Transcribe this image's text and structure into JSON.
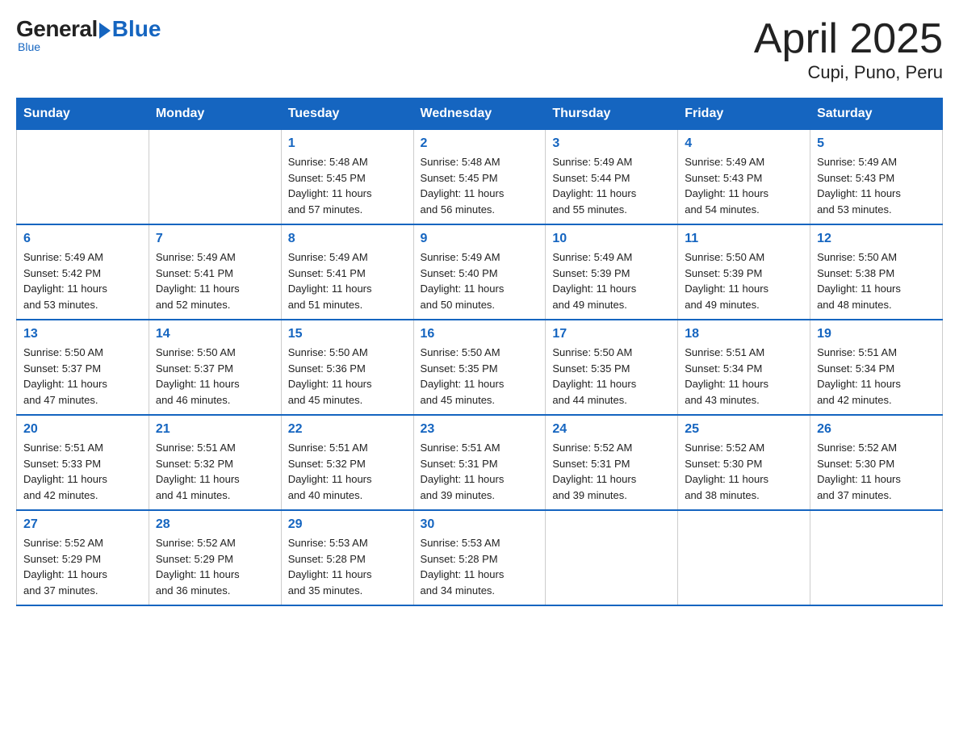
{
  "header": {
    "logo_general": "General",
    "logo_blue": "Blue",
    "title": "April 2025",
    "subtitle": "Cupi, Puno, Peru"
  },
  "weekdays": [
    "Sunday",
    "Monday",
    "Tuesday",
    "Wednesday",
    "Thursday",
    "Friday",
    "Saturday"
  ],
  "weeks": [
    [
      {
        "day": "",
        "info": ""
      },
      {
        "day": "",
        "info": ""
      },
      {
        "day": "1",
        "info": "Sunrise: 5:48 AM\nSunset: 5:45 PM\nDaylight: 11 hours\nand 57 minutes."
      },
      {
        "day": "2",
        "info": "Sunrise: 5:48 AM\nSunset: 5:45 PM\nDaylight: 11 hours\nand 56 minutes."
      },
      {
        "day": "3",
        "info": "Sunrise: 5:49 AM\nSunset: 5:44 PM\nDaylight: 11 hours\nand 55 minutes."
      },
      {
        "day": "4",
        "info": "Sunrise: 5:49 AM\nSunset: 5:43 PM\nDaylight: 11 hours\nand 54 minutes."
      },
      {
        "day": "5",
        "info": "Sunrise: 5:49 AM\nSunset: 5:43 PM\nDaylight: 11 hours\nand 53 minutes."
      }
    ],
    [
      {
        "day": "6",
        "info": "Sunrise: 5:49 AM\nSunset: 5:42 PM\nDaylight: 11 hours\nand 53 minutes."
      },
      {
        "day": "7",
        "info": "Sunrise: 5:49 AM\nSunset: 5:41 PM\nDaylight: 11 hours\nand 52 minutes."
      },
      {
        "day": "8",
        "info": "Sunrise: 5:49 AM\nSunset: 5:41 PM\nDaylight: 11 hours\nand 51 minutes."
      },
      {
        "day": "9",
        "info": "Sunrise: 5:49 AM\nSunset: 5:40 PM\nDaylight: 11 hours\nand 50 minutes."
      },
      {
        "day": "10",
        "info": "Sunrise: 5:49 AM\nSunset: 5:39 PM\nDaylight: 11 hours\nand 49 minutes."
      },
      {
        "day": "11",
        "info": "Sunrise: 5:50 AM\nSunset: 5:39 PM\nDaylight: 11 hours\nand 49 minutes."
      },
      {
        "day": "12",
        "info": "Sunrise: 5:50 AM\nSunset: 5:38 PM\nDaylight: 11 hours\nand 48 minutes."
      }
    ],
    [
      {
        "day": "13",
        "info": "Sunrise: 5:50 AM\nSunset: 5:37 PM\nDaylight: 11 hours\nand 47 minutes."
      },
      {
        "day": "14",
        "info": "Sunrise: 5:50 AM\nSunset: 5:37 PM\nDaylight: 11 hours\nand 46 minutes."
      },
      {
        "day": "15",
        "info": "Sunrise: 5:50 AM\nSunset: 5:36 PM\nDaylight: 11 hours\nand 45 minutes."
      },
      {
        "day": "16",
        "info": "Sunrise: 5:50 AM\nSunset: 5:35 PM\nDaylight: 11 hours\nand 45 minutes."
      },
      {
        "day": "17",
        "info": "Sunrise: 5:50 AM\nSunset: 5:35 PM\nDaylight: 11 hours\nand 44 minutes."
      },
      {
        "day": "18",
        "info": "Sunrise: 5:51 AM\nSunset: 5:34 PM\nDaylight: 11 hours\nand 43 minutes."
      },
      {
        "day": "19",
        "info": "Sunrise: 5:51 AM\nSunset: 5:34 PM\nDaylight: 11 hours\nand 42 minutes."
      }
    ],
    [
      {
        "day": "20",
        "info": "Sunrise: 5:51 AM\nSunset: 5:33 PM\nDaylight: 11 hours\nand 42 minutes."
      },
      {
        "day": "21",
        "info": "Sunrise: 5:51 AM\nSunset: 5:32 PM\nDaylight: 11 hours\nand 41 minutes."
      },
      {
        "day": "22",
        "info": "Sunrise: 5:51 AM\nSunset: 5:32 PM\nDaylight: 11 hours\nand 40 minutes."
      },
      {
        "day": "23",
        "info": "Sunrise: 5:51 AM\nSunset: 5:31 PM\nDaylight: 11 hours\nand 39 minutes."
      },
      {
        "day": "24",
        "info": "Sunrise: 5:52 AM\nSunset: 5:31 PM\nDaylight: 11 hours\nand 39 minutes."
      },
      {
        "day": "25",
        "info": "Sunrise: 5:52 AM\nSunset: 5:30 PM\nDaylight: 11 hours\nand 38 minutes."
      },
      {
        "day": "26",
        "info": "Sunrise: 5:52 AM\nSunset: 5:30 PM\nDaylight: 11 hours\nand 37 minutes."
      }
    ],
    [
      {
        "day": "27",
        "info": "Sunrise: 5:52 AM\nSunset: 5:29 PM\nDaylight: 11 hours\nand 37 minutes."
      },
      {
        "day": "28",
        "info": "Sunrise: 5:52 AM\nSunset: 5:29 PM\nDaylight: 11 hours\nand 36 minutes."
      },
      {
        "day": "29",
        "info": "Sunrise: 5:53 AM\nSunset: 5:28 PM\nDaylight: 11 hours\nand 35 minutes."
      },
      {
        "day": "30",
        "info": "Sunrise: 5:53 AM\nSunset: 5:28 PM\nDaylight: 11 hours\nand 34 minutes."
      },
      {
        "day": "",
        "info": ""
      },
      {
        "day": "",
        "info": ""
      },
      {
        "day": "",
        "info": ""
      }
    ]
  ]
}
